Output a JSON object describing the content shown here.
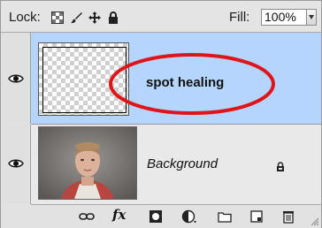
{
  "toolbar": {
    "lock_label": "Lock:",
    "lock_icons": [
      "lock-transparent-pixels-icon",
      "lock-image-pixels-icon",
      "lock-position-icon",
      "lock-all-icon"
    ],
    "fill_label": "Fill:",
    "fill_value": "100%"
  },
  "layers": [
    {
      "name": "spot healing",
      "visible": true,
      "selected": true,
      "thumbnail": "transparent-checkerboard"
    },
    {
      "name": "Background",
      "visible": true,
      "selected": false,
      "locked": true,
      "thumbnail": "portrait-photo"
    }
  ],
  "annotation": {
    "shape": "ellipse",
    "color": "#e0151b"
  },
  "bottom_icons": [
    "link-layers-icon",
    "layer-style-icon",
    "add-mask-icon",
    "adjustment-layer-icon",
    "new-group-icon",
    "new-layer-icon",
    "delete-layer-icon"
  ],
  "bottom_fx_label": "fx",
  "colors": {
    "selected_row": "#b6d5fe",
    "panel_bg": "#e3e3e3",
    "annotation": "#e0151b"
  }
}
